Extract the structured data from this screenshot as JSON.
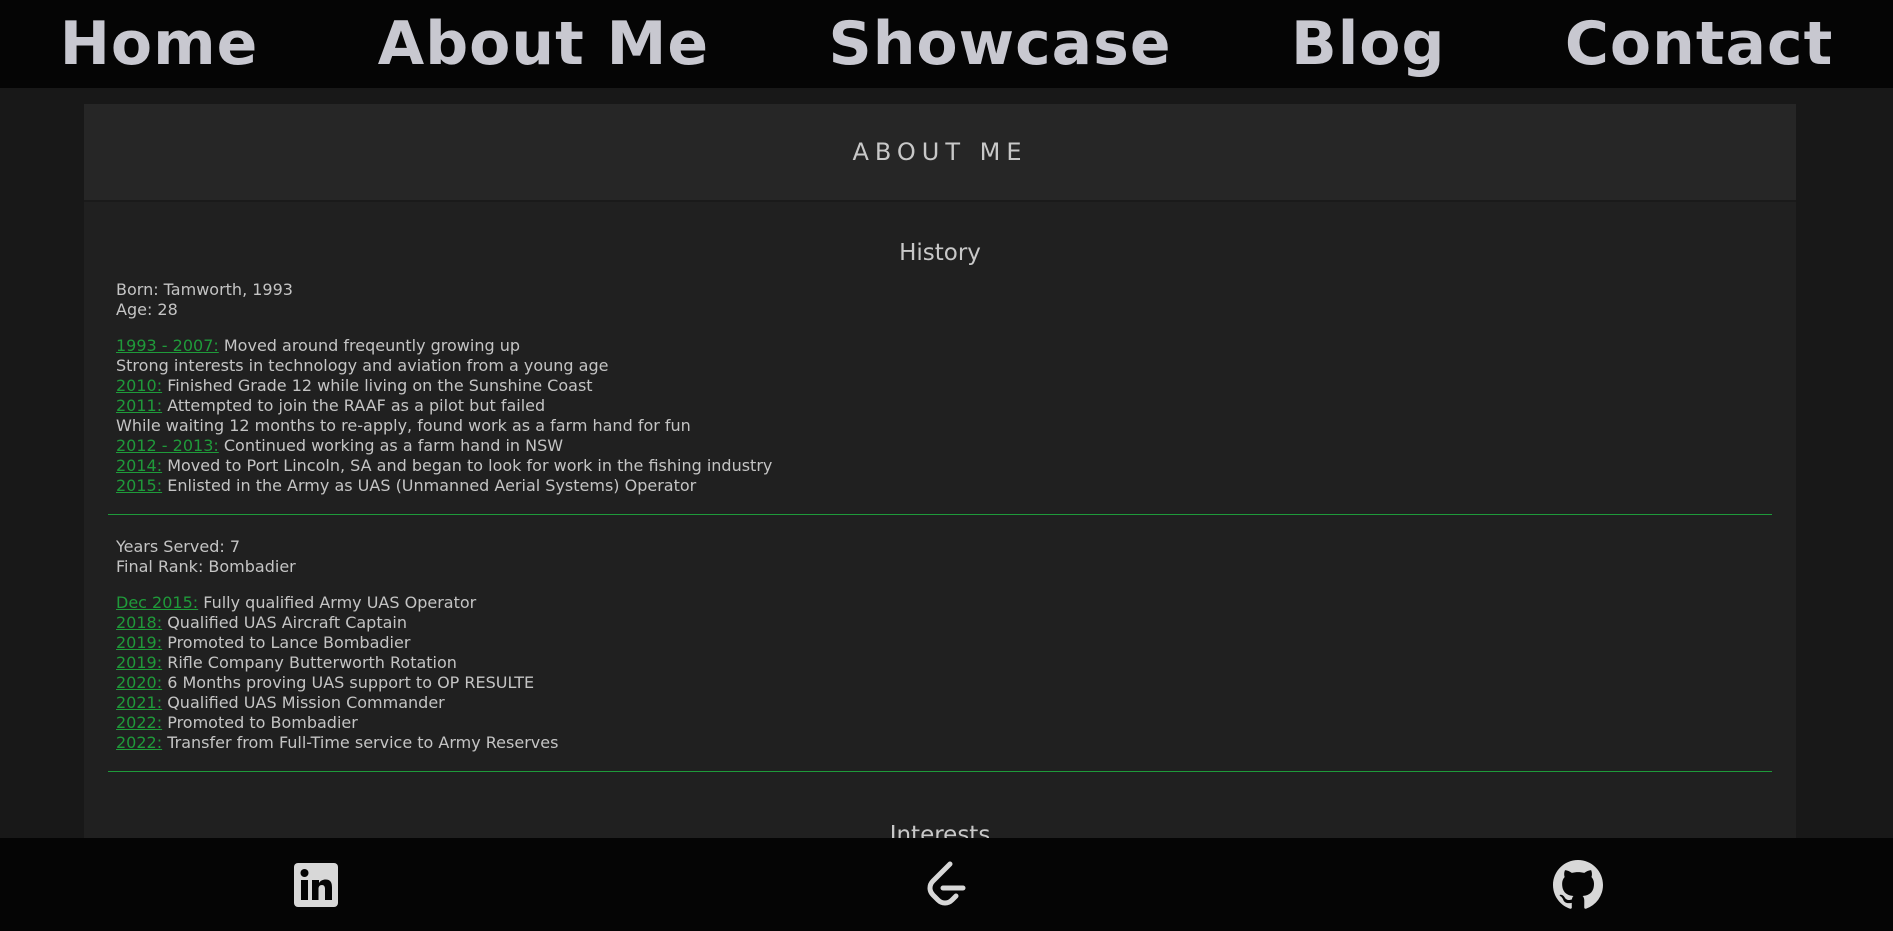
{
  "nav": {
    "items": [
      "Home",
      "About Me",
      "Showcase",
      "Blog",
      "Contact"
    ]
  },
  "page": {
    "title": "ABOUT ME"
  },
  "history": {
    "title": "History",
    "born": "Born: Tamworth, 1993",
    "age": "Age: 28",
    "timeline": [
      {
        "year": "1993 - 2007:",
        "text": "Moved around freqeuntly growing up"
      },
      {
        "year": "",
        "text": "Strong interests in technology and aviation from a young age"
      },
      {
        "year": "2010:",
        "text": "Finished Grade 12 while living on the Sunshine Coast"
      },
      {
        "year": "2011:",
        "text": "Attempted to join the RAAF as a pilot but failed"
      },
      {
        "year": "",
        "text": "While waiting 12 months to re-apply, found work as a farm hand for fun"
      },
      {
        "year": "2012 - 2013:",
        "text": "Continued working as a farm hand in NSW"
      },
      {
        "year": "2014:",
        "text": "Moved to Port Lincoln, SA and began to look for work in the fishing industry"
      },
      {
        "year": "2015:",
        "text": "Enlisted in the Army as UAS (Unmanned Aerial Systems) Operator"
      }
    ]
  },
  "army": {
    "years_served": "Years Served: 7",
    "final_rank": "Final Rank: Bombadier",
    "timeline": [
      {
        "year": "Dec 2015:",
        "text": "Fully qualified Army UAS Operator"
      },
      {
        "year": "2018:",
        "text": "Qualified UAS Aircraft Captain"
      },
      {
        "year": "2019:",
        "text": "Promoted to Lance Bombadier"
      },
      {
        "year": "2019:",
        "text": "Rifle Company Butterworth Rotation"
      },
      {
        "year": "2020:",
        "text": "6 Months proving UAS support to OP RESULTE"
      },
      {
        "year": "2021:",
        "text": "Qualified UAS Mission Commander"
      },
      {
        "year": "2022:",
        "text": "Promoted to Bombadier"
      },
      {
        "year": "2022:",
        "text": "Transfer from Full-Time service to Army Reserves"
      }
    ]
  },
  "interests": {
    "title": "Interests"
  },
  "footer": {
    "icons": [
      "linkedin-icon",
      "leetcode-icon",
      "github-icon"
    ]
  },
  "colors": {
    "accent": "#1f9a3a",
    "background": "#181818",
    "card": "#202020",
    "nav": "#050505",
    "text": "#c4c4c4"
  }
}
